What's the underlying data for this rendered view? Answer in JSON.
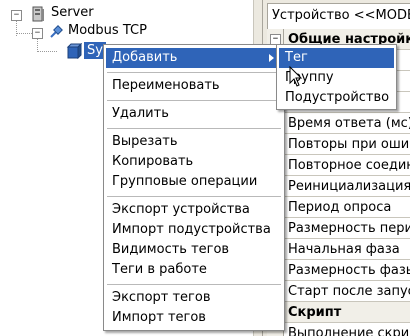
{
  "tree": {
    "root_label": "Server",
    "channel_label": "Modbus TCP",
    "device_label_visible": "Sy",
    "root_expander": "−",
    "channel_expander": "−"
  },
  "panel": {
    "header_title": "Устройство <<MODB",
    "section_general": "Общие настройк",
    "grid_expander": "−",
    "rows": [
      "Время ответа (мс)",
      "Повторы при ошиб",
      "Повторное соедин",
      "Реинициализация",
      "Период опроса",
      "Размерность пери",
      "Начальная фаза",
      "Размерность фазы",
      "Старт после запус"
    ],
    "section_script": "Скрипт",
    "last_row": "Выполнение скрип"
  },
  "context_menu": {
    "items": [
      "Добавить",
      "Переименовать",
      "Удалить",
      "Вырезать",
      "Копировать",
      "Групповые операции",
      "Экспорт устройства",
      "Импорт подустройства",
      "Видимость тегов",
      "Теги в работе",
      "Экспорт  тегов",
      "Импорт тегов"
    ]
  },
  "submenu": {
    "items": [
      "Тег",
      "Группу",
      "Подустройство"
    ]
  },
  "colors": {
    "selection": "#2f64b8",
    "panel_bg": "#ece9e0",
    "device_icon": "#2f64b8"
  }
}
